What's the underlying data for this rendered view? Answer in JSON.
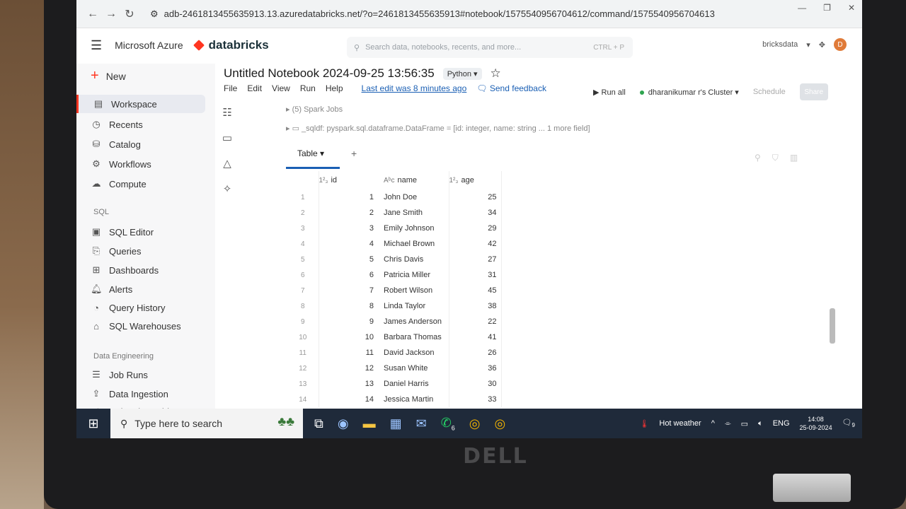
{
  "browser": {
    "url": "adb-2461813455635913.13.azuredatabricks.net/?o=2461813455635913#notebook/1575540956704612/command/1575540956704613"
  },
  "header": {
    "ms_label": "Microsoft Azure",
    "brand": "databricks",
    "search_placeholder": "Search data, notebooks, recents, and more...",
    "search_shortcut": "CTRL + P",
    "workspace_name": "bricksdata",
    "avatar_initial": "D"
  },
  "sidebar": {
    "new_label": "New",
    "items": [
      {
        "label": "Workspace",
        "icon": "workspace-icon"
      },
      {
        "label": "Recents",
        "icon": "clock-icon"
      },
      {
        "label": "Catalog",
        "icon": "catalog-icon"
      },
      {
        "label": "Workflows",
        "icon": "workflows-icon"
      },
      {
        "label": "Compute",
        "icon": "cloud-icon"
      }
    ],
    "sql_section": "SQL",
    "sql_items": [
      {
        "label": "SQL Editor"
      },
      {
        "label": "Queries"
      },
      {
        "label": "Dashboards"
      },
      {
        "label": "Alerts"
      },
      {
        "label": "Query History"
      },
      {
        "label": "SQL Warehouses"
      }
    ],
    "de_section": "Data Engineering",
    "de_items": [
      {
        "label": "Job Runs"
      },
      {
        "label": "Data Ingestion"
      },
      {
        "label": "Delta Live Tables"
      }
    ]
  },
  "notebook": {
    "title": "Untitled Notebook 2024-09-25 13:56:35",
    "language": "Python",
    "menu": [
      "File",
      "Edit",
      "View",
      "Run",
      "Help"
    ],
    "last_edit": "Last edit was 8 minutes ago",
    "feedback": "Send feedback",
    "run_all": "Run all",
    "cluster": "dharanikumar r's Cluster",
    "schedule": "Schedule",
    "share": "Share"
  },
  "cell": {
    "spark_jobs": "(5) Spark Jobs",
    "df_info": "_sqldf:  pyspark.sql.dataframe.DataFrame = [id: integer, name: string ... 1 more field]",
    "tab_label": "Table",
    "columns": [
      "id",
      "name",
      "age"
    ],
    "rows": [
      {
        "rn": "1",
        "id": "1",
        "name": "John Doe",
        "age": "25"
      },
      {
        "rn": "2",
        "id": "2",
        "name": "Jane Smith",
        "age": "34"
      },
      {
        "rn": "3",
        "id": "3",
        "name": "Emily Johnson",
        "age": "29"
      },
      {
        "rn": "4",
        "id": "4",
        "name": "Michael Brown",
        "age": "42"
      },
      {
        "rn": "5",
        "id": "5",
        "name": "Chris Davis",
        "age": "27"
      },
      {
        "rn": "6",
        "id": "6",
        "name": "Patricia Miller",
        "age": "31"
      },
      {
        "rn": "7",
        "id": "7",
        "name": "Robert Wilson",
        "age": "45"
      },
      {
        "rn": "8",
        "id": "8",
        "name": "Linda Taylor",
        "age": "38"
      },
      {
        "rn": "9",
        "id": "9",
        "name": "James Anderson",
        "age": "22"
      },
      {
        "rn": "10",
        "id": "10",
        "name": "Barbara Thomas",
        "age": "41"
      },
      {
        "rn": "11",
        "id": "11",
        "name": "David Jackson",
        "age": "26"
      },
      {
        "rn": "12",
        "id": "12",
        "name": "Susan White",
        "age": "36"
      },
      {
        "rn": "13",
        "id": "13",
        "name": "Daniel Harris",
        "age": "30"
      },
      {
        "rn": "14",
        "id": "14",
        "name": "Jessica Martin",
        "age": "33"
      }
    ]
  },
  "taskbar": {
    "search_placeholder": "Type here to search",
    "weather": "Hot weather",
    "lang": "ENG",
    "time": "14:08",
    "date": "25-09-2024",
    "whatsapp_badge": "6",
    "notif_badge": "9"
  },
  "device": {
    "brand": "DELL"
  }
}
